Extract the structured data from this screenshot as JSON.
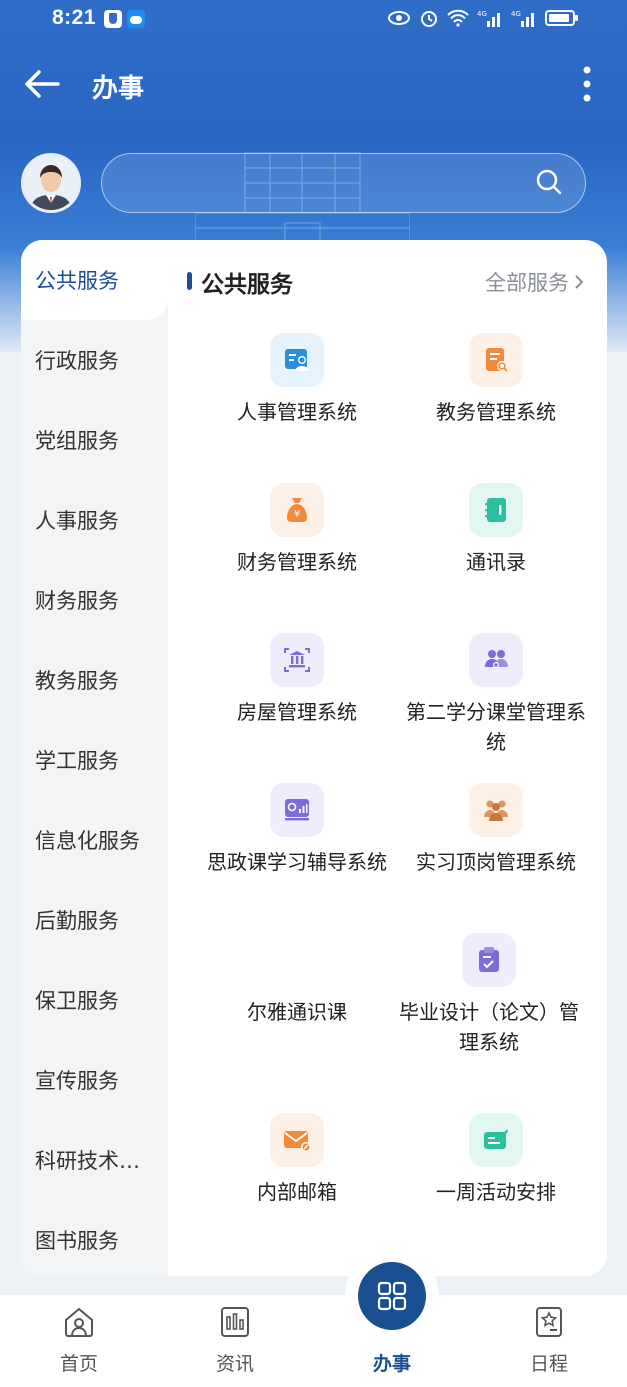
{
  "status_bar": {
    "time": "8:21"
  },
  "app_bar": {
    "title": "办事"
  },
  "search": {
    "placeholder": ""
  },
  "sidebar": {
    "items": [
      {
        "label": "公共服务",
        "active": true
      },
      {
        "label": "行政服务"
      },
      {
        "label": "党组服务"
      },
      {
        "label": "人事服务"
      },
      {
        "label": "财务服务"
      },
      {
        "label": "教务服务"
      },
      {
        "label": "学工服务"
      },
      {
        "label": "信息化服务"
      },
      {
        "label": "后勤服务"
      },
      {
        "label": "保卫服务"
      },
      {
        "label": "宣传服务"
      },
      {
        "label": "科研技术…"
      },
      {
        "label": "图书服务"
      }
    ]
  },
  "section": {
    "title": "公共服务",
    "all_link": "全部服务"
  },
  "services": [
    {
      "label": "人事管理系统",
      "icon": "personnel-icon",
      "color": "#2a8fd8",
      "bg": "#e6f3fc"
    },
    {
      "label": "教务管理系统",
      "icon": "academic-icon",
      "color": "#f28a3c",
      "bg": "#fdf0e6"
    },
    {
      "label": "财务管理系统",
      "icon": "money-bag-icon",
      "color": "#f28a3c",
      "bg": "#fdf0e6"
    },
    {
      "label": "通讯录",
      "icon": "contacts-icon",
      "color": "#2bbfa0",
      "bg": "#e3f7f2"
    },
    {
      "label": "房屋管理系统",
      "icon": "building-icon",
      "color": "#7b6cd9",
      "bg": "#efedfb"
    },
    {
      "label": "第二学分课堂管理系统",
      "icon": "group-icon",
      "color": "#7b6cd9",
      "bg": "#efedfb"
    },
    {
      "label": "思政课学习辅导系统",
      "icon": "chart-board-icon",
      "color": "#7b6cd9",
      "bg": "#efedfb"
    },
    {
      "label": "实习顶岗管理系统",
      "icon": "team-icon",
      "color": "#e0935a",
      "bg": "#fdf0e6"
    },
    {
      "label": "尔雅通识课",
      "icon": ""
    },
    {
      "label": "毕业设计（论文）管理系统",
      "icon": "clipboard-icon",
      "color": "#7b6cd9",
      "bg": "#efedfb"
    },
    {
      "label": "内部邮箱",
      "icon": "mail-icon",
      "color": "#f28a3c",
      "bg": "#fdf0e6"
    },
    {
      "label": "一周活动安排",
      "icon": "schedule-edit-icon",
      "color": "#2bbfa0",
      "bg": "#e3f7f2"
    }
  ],
  "bottom_nav": {
    "home": "首页",
    "news": "资讯",
    "affairs": "办事",
    "schedule": "日程"
  },
  "colors": {
    "primary": "#1a4f93",
    "header": "#2f6dc8"
  }
}
